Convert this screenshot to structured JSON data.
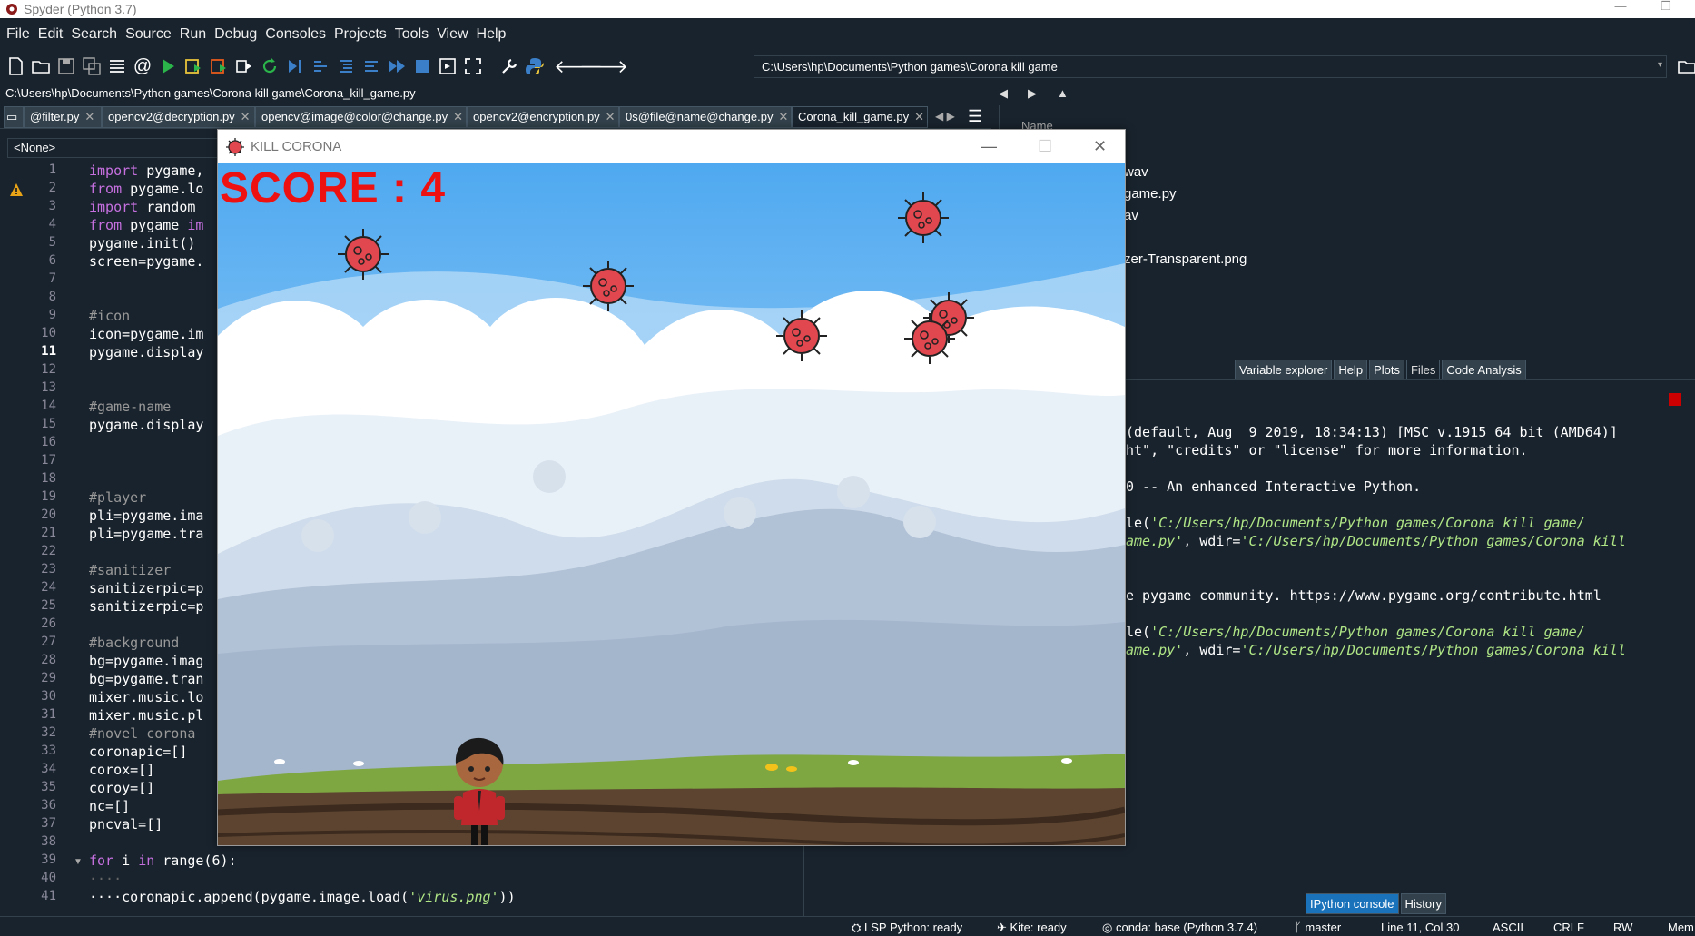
{
  "window": {
    "title": "Spyder (Python 3.7)"
  },
  "menu": [
    "File",
    "Edit",
    "Search",
    "Source",
    "Run",
    "Debug",
    "Consoles",
    "Projects",
    "Tools",
    "View",
    "Help"
  ],
  "working_dir": "C:\\Users\\hp\\Documents\\Python games\\Corona kill game",
  "editor": {
    "file_path": "C:\\Users\\hp\\Documents\\Python games\\Corona kill game\\Corona_kill_game.py",
    "tabs": [
      {
        "label": "@filter.py"
      },
      {
        "label": "opencv2@decryption.py"
      },
      {
        "label": "opencv@image@color@change.py"
      },
      {
        "label": "opencv2@encryption.py"
      },
      {
        "label": "0s@file@name@change.py"
      },
      {
        "label": "Corona_kill_game.py",
        "active": true
      }
    ],
    "class_selector": "<None>",
    "cursor_line": 11,
    "line_numbers": [
      "1",
      "2",
      "3",
      "4",
      "5",
      "6",
      "7",
      "8",
      "9",
      "10",
      "11",
      "12",
      "13",
      "14",
      "15",
      "16",
      "17",
      "18",
      "19",
      "20",
      "21",
      "22",
      "23",
      "24",
      "25",
      "26",
      "27",
      "28",
      "29",
      "30",
      "31",
      "32",
      "33",
      "34",
      "35",
      "36",
      "37",
      "38",
      "39",
      "40",
      "41"
    ],
    "code_visible": {
      "l1a": "import",
      "l1b": " pygame,",
      "l2a": "from",
      "l2b": " pygame.lo",
      "l3a": "import",
      "l3b": " random",
      "l4a": "from",
      "l4b": " pygame ",
      "l4c": "im",
      "l5": "pygame.init()",
      "l6": "screen=pygame.",
      "l9": "#icon",
      "l10": "icon=pygame.im",
      "l11": "pygame.display",
      "l14": "#game-name",
      "l15": "pygame.display",
      "l19": "#player",
      "l20": "pli=pygame.ima",
      "l21": "pli=pygame.tra",
      "l23": "#sanitizer",
      "l24": "sanitizerpic=p",
      "l25": "sanitizerpic=p",
      "l27": "#background",
      "l28": "bg=pygame.imag",
      "l29": "bg=pygame.tran",
      "l30": "mixer.music.lo",
      "l31": "mixer.music.pl",
      "l32": "#novel corona",
      "l33": "coronapic=[]",
      "l34": "corox=[]",
      "l35": "coroy=[]",
      "l36": "nc=[]",
      "l37": "pncval=[]",
      "l39a": "for",
      "l39b": " i ",
      "l39c": "in",
      "l39d": " range(6):",
      "l40": "····",
      "l41a": "····coronapic.append(pygame.image.load(",
      "l41b": "'virus.png'",
      "l41c": "))"
    }
  },
  "files_pane": {
    "header": "Name",
    "items": [
      "wav",
      "game.py",
      "av",
      "",
      "zer-Transparent.png"
    ]
  },
  "pane_tabs": [
    "Variable explorer",
    "Help",
    "Plots",
    "Files",
    "Code Analysis"
  ],
  "active_pane_tab": "Files",
  "console": {
    "l1": "(default, Aug  9 2019, 18:34:13) [MSC v.1915 64 bit (AMD64)]",
    "l2": "ht\", \"credits\" or \"license\" for more information.",
    "l3": "0 -- An enhanced Interactive Python.",
    "l4a": "le(",
    "l4b": "'C:/Users/hp/Documents/Python games/Corona kill game/",
    "l5a": "ame.py'",
    "l5b": ", wdir=",
    "l5c": "'C:/Users/hp/Documents/Python games/Corona kill",
    "l6": "e pygame community. https://www.pygame.org/contribute.html",
    "l7a": "le(",
    "l7b": "'C:/Users/hp/Documents/Python games/Corona kill game/",
    "l8a": "ame.py'",
    "l8b": ", wdir=",
    "l8c": "'C:/Users/hp/Documents/Python games/Corona kill"
  },
  "console_tabs": [
    "IPython console",
    "History"
  ],
  "status": {
    "lsp": "LSP Python: ready",
    "kite": "Kite: ready",
    "conda": "conda: base (Python 3.7.4)",
    "branch": "master",
    "position": "Line 11, Col 30",
    "encoding": "ASCII",
    "eol": "CRLF",
    "perm": "RW",
    "mem": "Mem"
  },
  "game": {
    "title": "KILL CORONA",
    "score": "SCORE : 4",
    "viruses": 6
  }
}
